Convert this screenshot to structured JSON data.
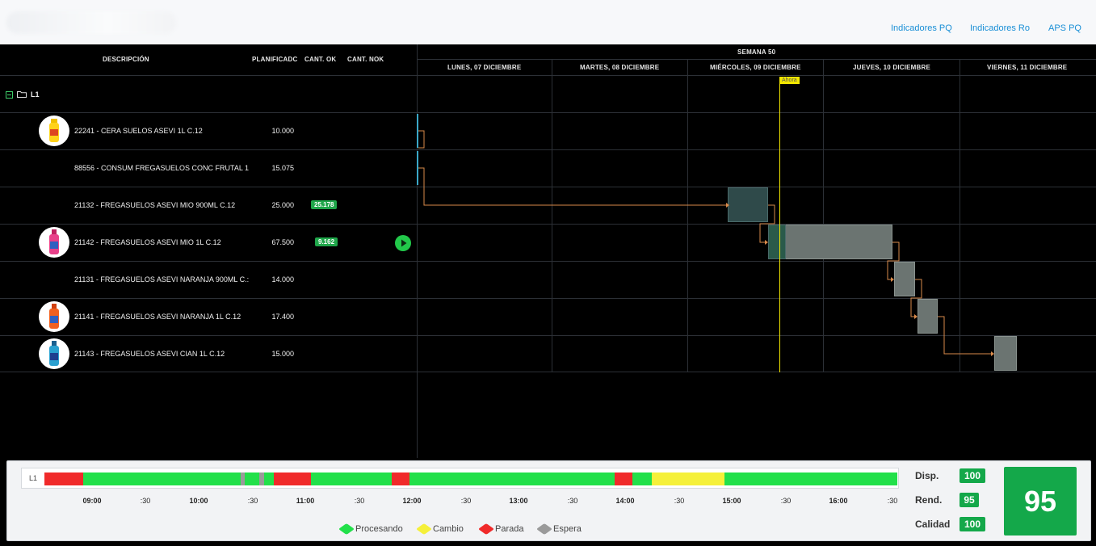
{
  "nav": {
    "link1": "Indicadores PQ",
    "link2": "Indicadores Ro",
    "link3": "APS PQ"
  },
  "table": {
    "headers": {
      "descripcion": "DESCRIPCIÓN",
      "planificado": "PLANIFICADC",
      "cant_ok": "CANT. OK",
      "cant_nok": "CANT. NOK"
    },
    "group": "L1",
    "rows": [
      {
        "desc": "22241 - CERA SUELOS ASEVI 1L C.12",
        "plan": "10.000",
        "ok": ""
      },
      {
        "desc": "88556 - CONSUM FREGASUELOS CONC FRUTAL 1",
        "plan": "15.075",
        "ok": ""
      },
      {
        "desc": "21132 - FREGASUELOS ASEVI MIO 900ML C.12",
        "plan": "25.000",
        "ok": "25.178"
      },
      {
        "desc": "21142 - FREGASUELOS ASEVI MIO 1L C.12",
        "plan": "67.500",
        "ok": "9.162"
      },
      {
        "desc": "21131 - FREGASUELOS ASEVI NARANJA 900ML C.:",
        "plan": "14.000",
        "ok": ""
      },
      {
        "desc": "21141 - FREGASUELOS ASEVI NARANJA 1L C.12",
        "plan": "17.400",
        "ok": ""
      },
      {
        "desc": "21143 - FREGASUELOS ASEVI CIAN 1L C.12",
        "plan": "15.000",
        "ok": ""
      }
    ]
  },
  "gantt": {
    "week": "SEMANA 50",
    "days": [
      "LUNES, 07 DICIEMBRE",
      "MARTES, 08 DICIEMBRE",
      "MIÉRCOLES, 09 DICIEMBRE",
      "JUEVES, 10 DICIEMBRE",
      "VIERNES, 11 DICIEMBRE"
    ],
    "now_label": "Ahora"
  },
  "timeline": {
    "line_label": "L1",
    "ticks": [
      "09:00",
      ":30",
      "10:00",
      ":30",
      "11:00",
      ":30",
      "12:00",
      ":30",
      "13:00",
      ":30",
      "14:00",
      ":30",
      "15:00",
      ":30",
      "16:00",
      ":30"
    ],
    "colors": {
      "procesando": "#22e04a",
      "cambio": "#f5f03a",
      "parada": "#f02a2a",
      "espera": "#9a9a9a"
    }
  },
  "legend": {
    "procesando": "Procesando",
    "cambio": "Cambio",
    "parada": "Parada",
    "espera": "Espera"
  },
  "kpis": {
    "disp_label": "Disp.",
    "disp_value": "100",
    "rend_label": "Rend.",
    "rend_value": "95",
    "calidad_label": "Calidad",
    "calidad_value": "100",
    "oee": "95"
  }
}
